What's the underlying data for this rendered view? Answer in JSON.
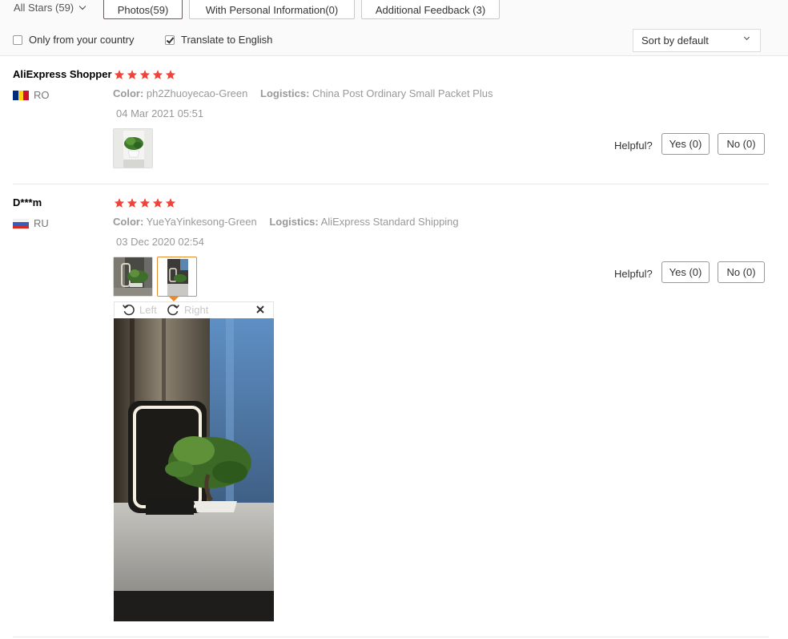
{
  "filters": {
    "stars_label": "All Stars (59)",
    "tabs": [
      {
        "label": "Photos(59)"
      },
      {
        "label": "With Personal Information(0)"
      },
      {
        "label": "Additional Feedback (3)"
      }
    ],
    "only_country_label": "Only from your country",
    "translate_label": "Translate to English",
    "sort_label": "Sort by default"
  },
  "reviews": [
    {
      "user": "AliExpress Shopper",
      "country_code": "RO",
      "rating": 5,
      "color_label": "Color:",
      "color_value": "ph2Zhuoyecao-Green",
      "logistics_label": "Logistics:",
      "logistics_value": "China Post Ordinary Small Packet Plus",
      "date": "04 Mar 2021 05:51",
      "helpful_label": "Helpful?",
      "yes_label": "Yes (0)",
      "no_label": "No (0)"
    },
    {
      "user": "D***m",
      "country_code": "RU",
      "rating": 5,
      "color_label": "Color:",
      "color_value": "YueYaYinkesong-Green",
      "logistics_label": "Logistics:",
      "logistics_value": "AliExpress Standard Shipping",
      "date": "03 Dec 2020 02:54",
      "helpful_label": "Helpful?",
      "yes_label": "Yes (0)",
      "no_label": "No (0)"
    }
  ],
  "viewer": {
    "left_label": "Left",
    "right_label": "Right",
    "icons": [
      "rotate-left-icon",
      "rotate-right-icon",
      "close-icon"
    ]
  },
  "colors": {
    "active_tab_border": "#e62e04",
    "star": "#f44336",
    "selected_thumb_border": "#e88a2e"
  }
}
